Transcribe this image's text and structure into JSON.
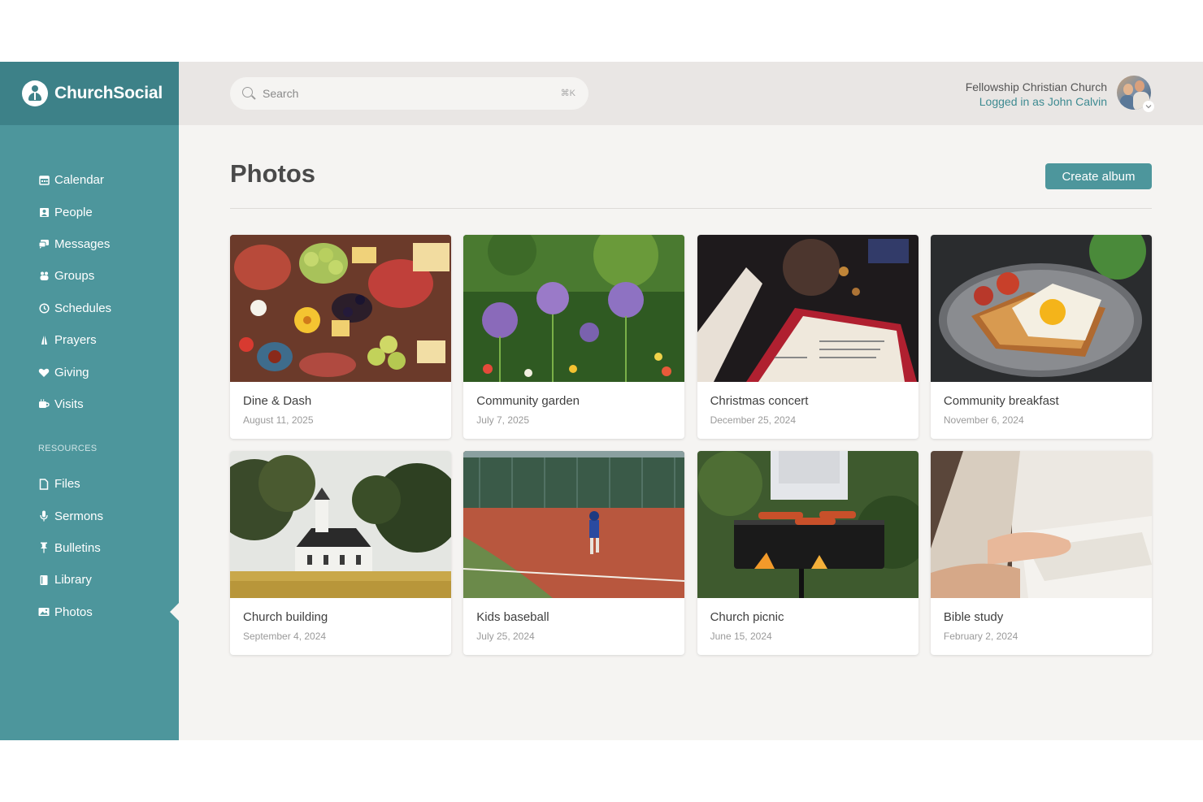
{
  "brand": {
    "name": "ChurchSocial"
  },
  "sidebar": {
    "items": [
      {
        "label": "Calendar",
        "icon": "calendar-icon"
      },
      {
        "label": "People",
        "icon": "people-icon"
      },
      {
        "label": "Messages",
        "icon": "messages-icon"
      },
      {
        "label": "Groups",
        "icon": "groups-icon"
      },
      {
        "label": "Schedules",
        "icon": "clock-icon"
      },
      {
        "label": "Prayers",
        "icon": "praying-hands-icon"
      },
      {
        "label": "Giving",
        "icon": "heart-icon"
      },
      {
        "label": "Visits",
        "icon": "coffee-cup-icon"
      }
    ],
    "section_label": "RESOURCES",
    "resources": [
      {
        "label": "Files",
        "icon": "file-icon"
      },
      {
        "label": "Sermons",
        "icon": "microphone-icon"
      },
      {
        "label": "Bulletins",
        "icon": "pin-icon"
      },
      {
        "label": "Library",
        "icon": "book-icon"
      },
      {
        "label": "Photos",
        "icon": "image-icon",
        "active": true
      }
    ]
  },
  "header": {
    "search_placeholder": "Search",
    "search_shortcut": "⌘K",
    "church_name": "Fellowship Christian Church",
    "logged_in": "Logged in as John Calvin"
  },
  "page": {
    "title": "Photos",
    "create_button": "Create album"
  },
  "albums": [
    {
      "title": "Dine & Dash",
      "date": "August 11, 2025"
    },
    {
      "title": "Community garden",
      "date": "July 7, 2025"
    },
    {
      "title": "Christmas concert",
      "date": "December 25, 2024"
    },
    {
      "title": "Community breakfast",
      "date": "November 6, 2024"
    },
    {
      "title": "Church building",
      "date": "September 4, 2024"
    },
    {
      "title": "Kids baseball",
      "date": "July 25, 2024"
    },
    {
      "title": "Church picnic",
      "date": "June 15, 2024"
    },
    {
      "title": "Bible study",
      "date": "February 2, 2024"
    }
  ],
  "colors": {
    "accent": "#4d969c",
    "brand_dark": "#3d8188",
    "link": "#3d8a91"
  }
}
